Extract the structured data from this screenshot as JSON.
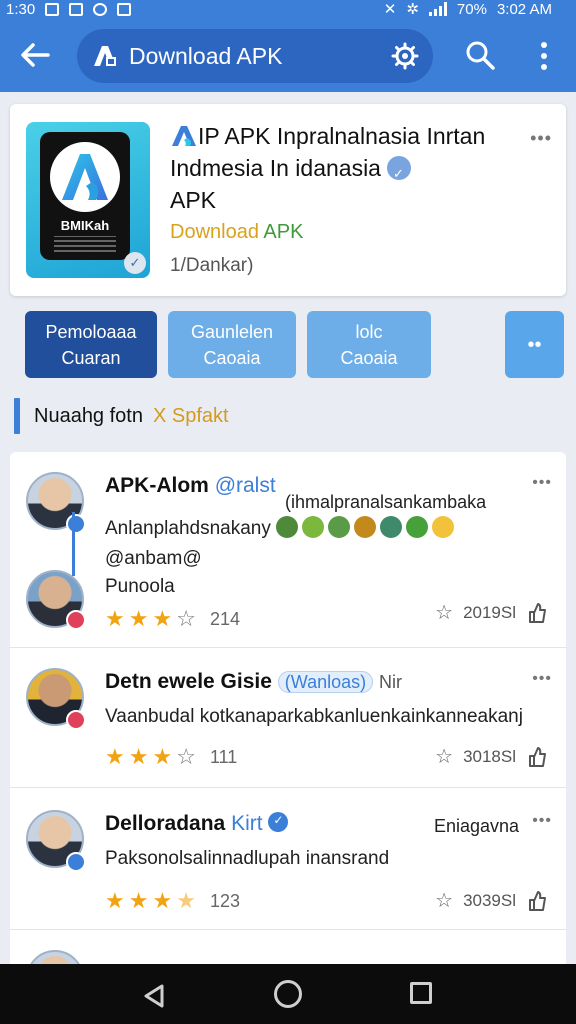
{
  "status": {
    "time": "1:30",
    "clock": "3:02 AM",
    "battery": "70%"
  },
  "appbar": {
    "title": "Download APK"
  },
  "app": {
    "title_line1": "IP APK Inpralnalnasia Inrtan",
    "title_line2": "Indmesia In idanasia",
    "title_line3": "APK",
    "download_a": "Download",
    "download_b": "APK",
    "subline": "1/Dankar)",
    "icon_brand": "BMIKah"
  },
  "actions": {
    "primary_l1": "Pemoloaaa",
    "primary_l2": "Cuaran",
    "sec1_l1": "Gaunlelen",
    "sec1_l2": "Caoaia",
    "sec2_l1": "lolc",
    "sec2_l2": "Caoaia",
    "more": "••"
  },
  "section": {
    "title": "Nuaahg fotn",
    "subtitle": "X Spfakt"
  },
  "reviews": [
    {
      "name": "APK-Alom",
      "handle": "@ralst",
      "aside": "(ihmalpranalsankambaka",
      "line1": "Anlanplahdsnakany",
      "line2": "@anbam@",
      "line3": "Punoola",
      "count": "214",
      "stat": "2019Sl",
      "colors": {
        "star_on": "#f2a30f"
      }
    },
    {
      "name": "Detn ewele Gisie",
      "tag": "(Wanloas)",
      "extra": "Nir",
      "line1": "Vaanbudal kotkanaparkabkanluenkainkanneakanj",
      "count": "111",
      "stat": "3018Sl"
    },
    {
      "name": "Delloradana",
      "handle": "Kirt",
      "aside": "Eniagavna",
      "line1": "Paksonolsalinnadlupah inansrand",
      "count": "123",
      "stat": "3039Sl"
    }
  ]
}
